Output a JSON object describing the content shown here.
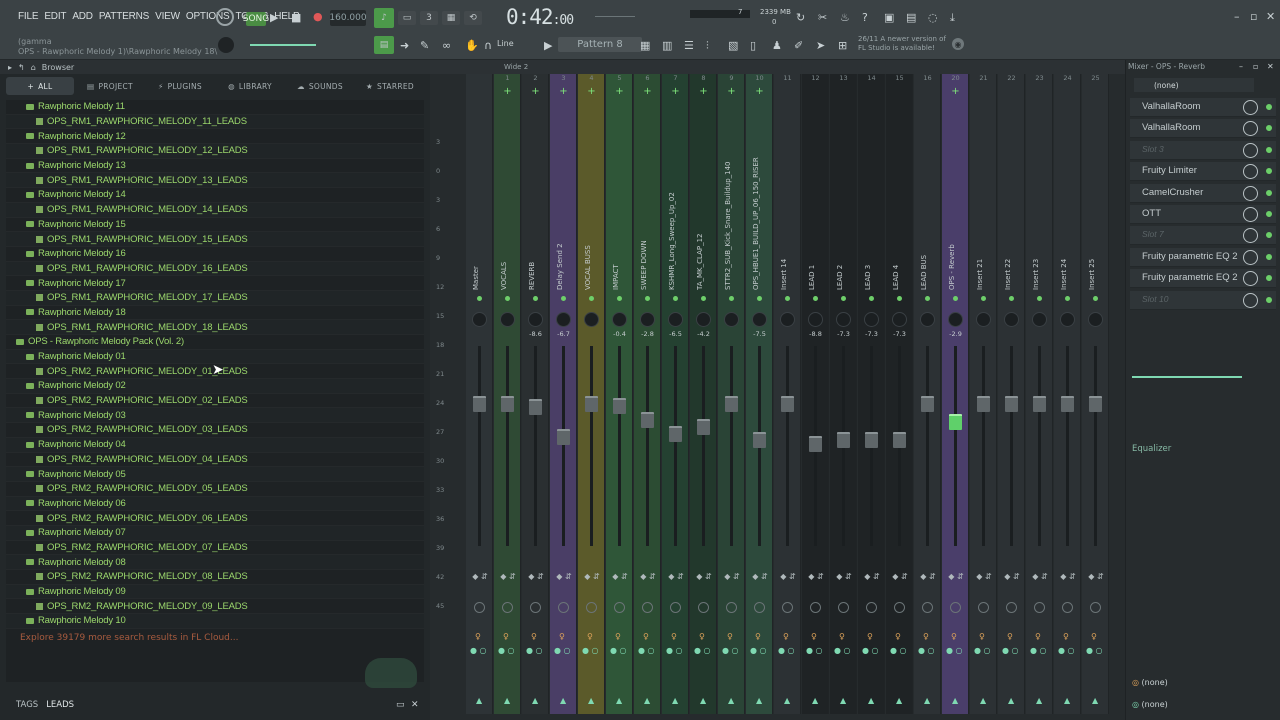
{
  "menu": [
    "FILE",
    "EDIT",
    "ADD",
    "PATTERNS",
    "VIEW",
    "OPTIONS",
    "TOOLS",
    "HELP"
  ],
  "transport": {
    "tempo": "160.000",
    "time": "0:42",
    "time_small": ":00",
    "cpu": "7",
    "mem": "2339 MB",
    "poly": "0",
    "mode_label": "SONG"
  },
  "hint": {
    "line1": "(gamma",
    "line2": "OPS - Rawphoric Melody 1)\\Rawphoric Melody 18\\"
  },
  "toolbar": {
    "snap": "Line",
    "pattern": "Pattern 8"
  },
  "news": {
    "date": "26/11",
    "line1": "A newer version of",
    "line2": "FL Studio is available!"
  },
  "browser": {
    "title": "Browser",
    "tabs": [
      {
        "label": "ALL",
        "icon": "plus-icon"
      },
      {
        "label": "PROJECT",
        "icon": "document-icon"
      },
      {
        "label": "PLUGINS",
        "icon": "plug-icon"
      },
      {
        "label": "LIBRARY",
        "icon": "globe-icon"
      },
      {
        "label": "SOUNDS",
        "icon": "cloud-icon"
      },
      {
        "label": "STARRED",
        "icon": "star-icon"
      }
    ],
    "rows": [
      {
        "type": "folder",
        "indent": 1,
        "label": "Rawphoric Melody 11"
      },
      {
        "type": "file",
        "indent": 2,
        "label": "OPS_RM1_RAWPHORIC_MELODY_11_LEADS"
      },
      {
        "type": "folder",
        "indent": 1,
        "label": "Rawphoric Melody 12"
      },
      {
        "type": "file",
        "indent": 2,
        "label": "OPS_RM1_RAWPHORIC_MELODY_12_LEADS"
      },
      {
        "type": "folder",
        "indent": 1,
        "label": "Rawphoric Melody 13"
      },
      {
        "type": "file",
        "indent": 2,
        "label": "OPS_RM1_RAWPHORIC_MELODY_13_LEADS"
      },
      {
        "type": "folder",
        "indent": 1,
        "label": "Rawphoric Melody 14"
      },
      {
        "type": "file",
        "indent": 2,
        "label": "OPS_RM1_RAWPHORIC_MELODY_14_LEADS"
      },
      {
        "type": "folder",
        "indent": 1,
        "label": "Rawphoric Melody 15"
      },
      {
        "type": "file",
        "indent": 2,
        "label": "OPS_RM1_RAWPHORIC_MELODY_15_LEADS"
      },
      {
        "type": "folder",
        "indent": 1,
        "label": "Rawphoric Melody 16"
      },
      {
        "type": "file",
        "indent": 2,
        "label": "OPS_RM1_RAWPHORIC_MELODY_16_LEADS"
      },
      {
        "type": "folder",
        "indent": 1,
        "label": "Rawphoric Melody 17"
      },
      {
        "type": "file",
        "indent": 2,
        "label": "OPS_RM1_RAWPHORIC_MELODY_17_LEADS"
      },
      {
        "type": "folder",
        "indent": 1,
        "label": "Rawphoric Melody 18"
      },
      {
        "type": "file",
        "indent": 2,
        "label": "OPS_RM1_RAWPHORIC_MELODY_18_LEADS"
      },
      {
        "type": "folder",
        "indent": 0,
        "label": "OPS - Rawphoric Melody Pack (Vol. 2)"
      },
      {
        "type": "folder",
        "indent": 1,
        "label": "Rawphoric Melody 01"
      },
      {
        "type": "file",
        "indent": 2,
        "label": "OPS_RM2_RAWPHORIC_MELODY_01_LEADS"
      },
      {
        "type": "folder",
        "indent": 1,
        "label": "Rawphoric Melody 02"
      },
      {
        "type": "file",
        "indent": 2,
        "label": "OPS_RM2_RAWPHORIC_MELODY_02_LEADS"
      },
      {
        "type": "folder",
        "indent": 1,
        "label": "Rawphoric Melody 03"
      },
      {
        "type": "file",
        "indent": 2,
        "label": "OPS_RM2_RAWPHORIC_MELODY_03_LEADS"
      },
      {
        "type": "folder",
        "indent": 1,
        "label": "Rawphoric Melody 04"
      },
      {
        "type": "file",
        "indent": 2,
        "label": "OPS_RM2_RAWPHORIC_MELODY_04_LEADS"
      },
      {
        "type": "folder",
        "indent": 1,
        "label": "Rawphoric Melody 05"
      },
      {
        "type": "file",
        "indent": 2,
        "label": "OPS_RM2_RAWPHORIC_MELODY_05_LEADS"
      },
      {
        "type": "folder",
        "indent": 1,
        "label": "Rawphoric Melody 06"
      },
      {
        "type": "file",
        "indent": 2,
        "label": "OPS_RM2_RAWPHORIC_MELODY_06_LEADS"
      },
      {
        "type": "folder",
        "indent": 1,
        "label": "Rawphoric Melody 07"
      },
      {
        "type": "file",
        "indent": 2,
        "label": "OPS_RM2_RAWPHORIC_MELODY_07_LEADS"
      },
      {
        "type": "folder",
        "indent": 1,
        "label": "Rawphoric Melody 08"
      },
      {
        "type": "file",
        "indent": 2,
        "label": "OPS_RM2_RAWPHORIC_MELODY_08_LEADS"
      },
      {
        "type": "folder",
        "indent": 1,
        "label": "Rawphoric Melody 09"
      },
      {
        "type": "file",
        "indent": 2,
        "label": "OPS_RM2_RAWPHORIC_MELODY_09_LEADS"
      },
      {
        "type": "folder",
        "indent": 1,
        "label": "Rawphoric Melody 10"
      }
    ],
    "cloud_text": "Explore 39179 more search results in FL Cloud...",
    "tags_label": "TAGS",
    "search_value": "LEADS"
  },
  "mixer": {
    "title": "Wide 2",
    "scale": [
      "3",
      "0",
      "3",
      "6",
      "9",
      "12",
      "15",
      "18",
      "21",
      "24",
      "27",
      "30",
      "33",
      "36",
      "39",
      "42",
      "45"
    ],
    "tracks": [
      {
        "num": "",
        "name": "Master",
        "val": "",
        "fader": 0.45,
        "color": "#2d3336"
      },
      {
        "num": "1",
        "name": "VOCALS",
        "val": "",
        "fader": 0.45,
        "color": "#2f4a34"
      },
      {
        "num": "2",
        "name": "REVERB",
        "val": "-8.6",
        "fader": 0.48,
        "color": "#2a2f31"
      },
      {
        "num": "3",
        "name": "Delay Send 2",
        "val": "-6.7",
        "fader": 0.75,
        "color": "#4a3e66"
      },
      {
        "num": "4",
        "name": "VOCAL BUSS",
        "val": "",
        "fader": 0.45,
        "color": "#5b5a2a"
      },
      {
        "num": "5",
        "name": "IMPACT",
        "val": "-0.4",
        "fader": 0.47,
        "color": "#2f5638"
      },
      {
        "num": "6",
        "name": "SWEEP DOWN",
        "val": "-2.8",
        "fader": 0.6,
        "color": "#2c4c33"
      },
      {
        "num": "7",
        "name": "KSHMR_Long_Sweep_Up_02",
        "val": "-6.5",
        "fader": 0.73,
        "color": "#244131"
      },
      {
        "num": "8",
        "name": "TA_MK_CLAP_12",
        "val": "-4.2",
        "fader": 0.66,
        "color": "#22382c"
      },
      {
        "num": "9",
        "name": "STTR2_SUB_Kick_Snare_Buildup_140",
        "val": "",
        "fader": 0.45,
        "color": "#2a4436"
      },
      {
        "num": "10",
        "name": "OPS_HBUE1_BUILD_UP_06_150_RISER",
        "val": "-7.5",
        "fader": 0.78,
        "color": "#2d4a3c"
      },
      {
        "num": "11",
        "name": "Insert 14",
        "val": "",
        "fader": 0.45,
        "color": "#2c3134"
      },
      {
        "num": "12",
        "name": "LEAD 1",
        "val": "-8.8",
        "fader": 0.82,
        "color": "#1f2325"
      },
      {
        "num": "13",
        "name": "LEAD 2",
        "val": "-7.3",
        "fader": 0.78,
        "color": "#1f2325"
      },
      {
        "num": "14",
        "name": "LEAD 3",
        "val": "-7.3",
        "fader": 0.78,
        "color": "#1f2325"
      },
      {
        "num": "15",
        "name": "LEAD 4",
        "val": "-7.3",
        "fader": 0.78,
        "color": "#1f2325"
      },
      {
        "num": "16",
        "name": "LEAD BUS",
        "val": "",
        "fader": 0.45,
        "color": "#2c3134"
      },
      {
        "num": "20",
        "name": "OPS - Reverb",
        "val": "-2.9",
        "fader": 0.62,
        "color": "#4a3e6a"
      },
      {
        "num": "21",
        "name": "Insert 21",
        "val": "",
        "fader": 0.45,
        "color": "#2c3134"
      },
      {
        "num": "22",
        "name": "Insert 22",
        "val": "",
        "fader": 0.45,
        "color": "#2c3134"
      },
      {
        "num": "23",
        "name": "Insert 23",
        "val": "",
        "fader": 0.45,
        "color": "#2c3134"
      },
      {
        "num": "24",
        "name": "Insert 24",
        "val": "",
        "fader": 0.45,
        "color": "#2c3134"
      },
      {
        "num": "25",
        "name": "Insert 25",
        "val": "",
        "fader": 0.45,
        "color": "#2c3134"
      }
    ]
  },
  "fx": {
    "title": "Mixer - OPS - Reverb",
    "input": "(none)",
    "slots": [
      {
        "label": "ValhallaRoom",
        "empty": false
      },
      {
        "label": "ValhallaRoom",
        "empty": false
      },
      {
        "label": "Slot 3",
        "empty": true
      },
      {
        "label": "Fruity Limiter",
        "empty": false
      },
      {
        "label": "CamelCrusher",
        "empty": false
      },
      {
        "label": "OTT",
        "empty": false
      },
      {
        "label": "Slot 7",
        "empty": true
      },
      {
        "label": "Fruity parametric EQ 2",
        "empty": false
      },
      {
        "label": "Fruity parametric EQ 2",
        "empty": false
      },
      {
        "label": "Slot 10",
        "empty": true
      }
    ],
    "eq_label": "Equalizer",
    "out1": "(none)",
    "out2": "(none)"
  }
}
